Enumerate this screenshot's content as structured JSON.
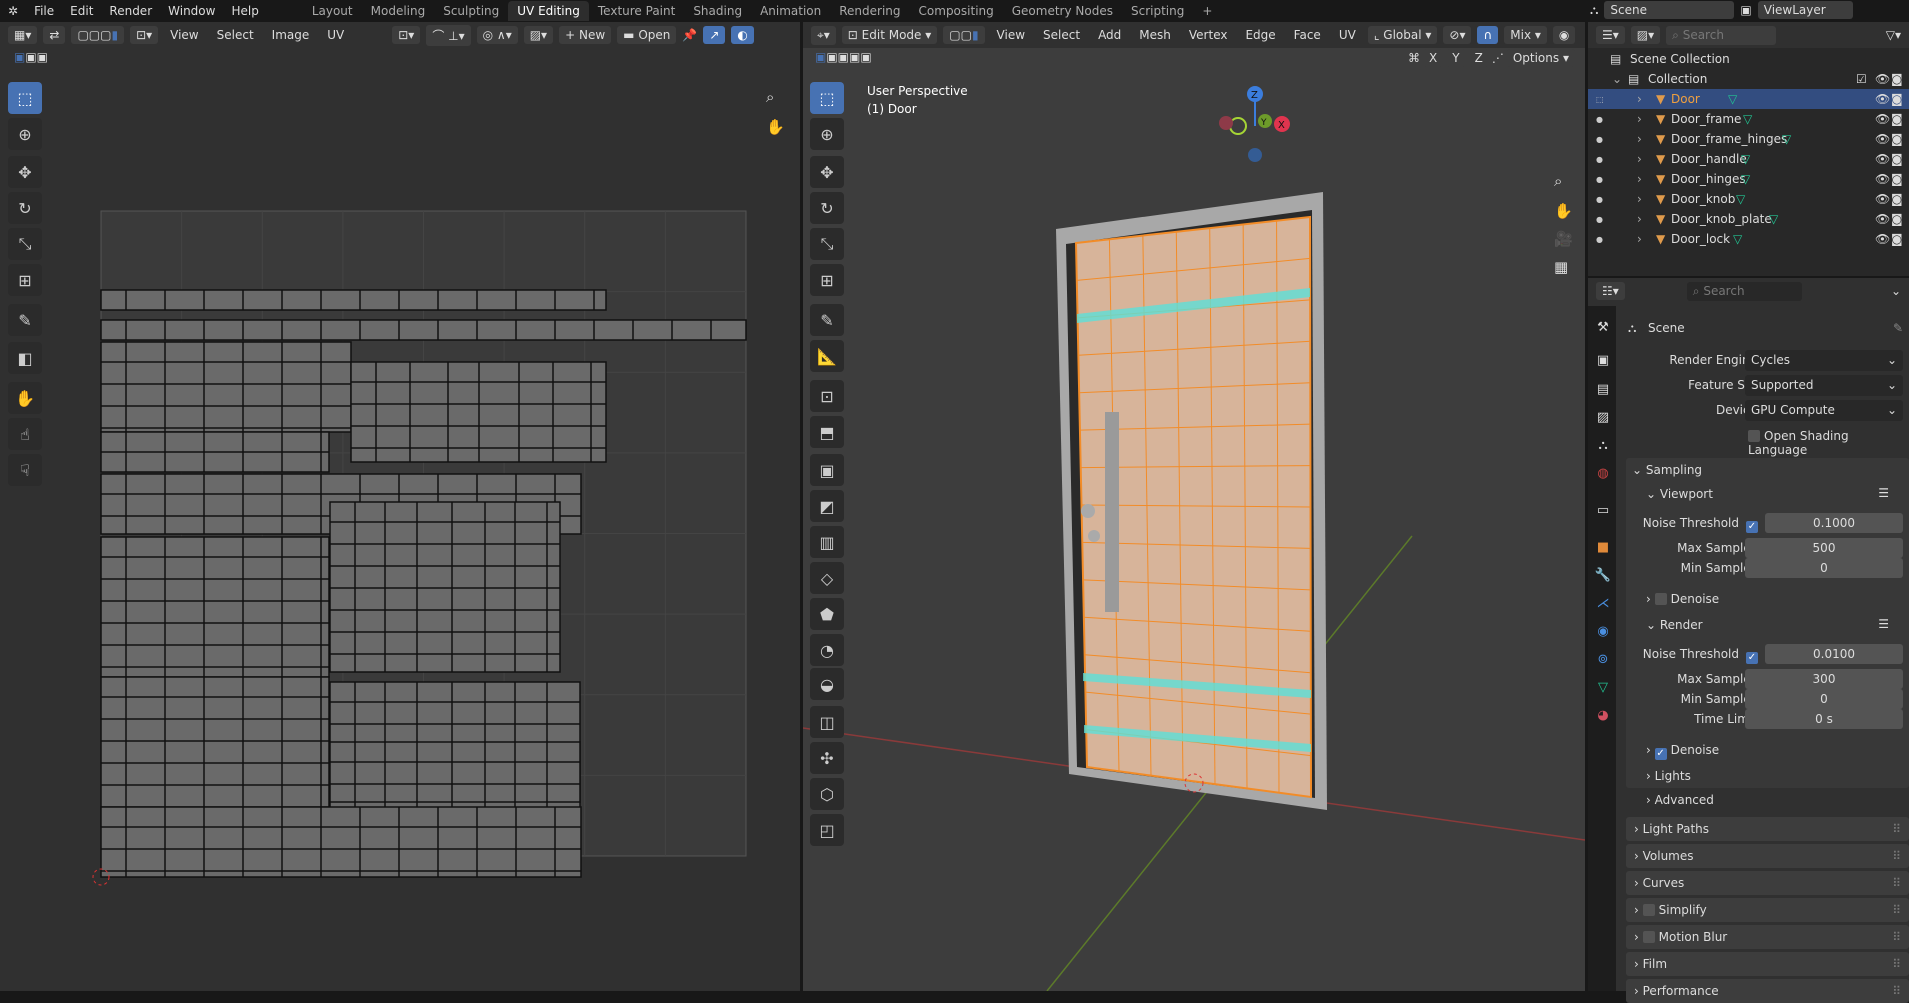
{
  "topbar": {
    "menus": [
      "File",
      "Edit",
      "Render",
      "Window",
      "Help"
    ],
    "tabs": [
      "Layout",
      "Modeling",
      "Sculpting",
      "UV Editing",
      "Texture Paint",
      "Shading",
      "Animation",
      "Rendering",
      "Compositing",
      "Geometry Nodes",
      "Scripting",
      "+"
    ],
    "active_tab": "UV Editing",
    "scene": "Scene",
    "view_layer": "ViewLayer"
  },
  "uv_editor": {
    "menus": [
      "View",
      "Select",
      "Image",
      "UV"
    ],
    "new_label": "New",
    "open_label": "Open"
  },
  "viewport": {
    "mode": "Edit Mode",
    "menus": [
      "View",
      "Select",
      "Add",
      "Mesh",
      "Vertex",
      "Edge",
      "Face",
      "UV"
    ],
    "orientation": "Global",
    "shading_mix": "Mix",
    "axes": [
      "X",
      "Y",
      "Z"
    ],
    "options_label": "Options",
    "overlay_title": "User Perspective",
    "overlay_object": "(1) Door",
    "gizmo": {
      "z": "Z",
      "y": "Y",
      "x": "X"
    }
  },
  "outliner": {
    "search_placeholder": "Search",
    "scene_collection": "Scene Collection",
    "collection": "Collection",
    "objects": [
      "Door",
      "Door_frame",
      "Door_frame_hinges",
      "Door_handle",
      "Door_hinges",
      "Door_knob",
      "Door_knob_plate",
      "Door_lock"
    ],
    "selected": "Door"
  },
  "properties": {
    "search_placeholder": "Search",
    "context": "Scene",
    "render_engine": {
      "label": "Render Engine",
      "value": "Cycles"
    },
    "feature_set": {
      "label": "Feature Set",
      "value": "Supported"
    },
    "device": {
      "label": "Device",
      "value": "GPU Compute"
    },
    "osl": {
      "label": "Open Shading Language",
      "checked": false
    },
    "sampling": {
      "label": "Sampling",
      "viewport": {
        "label": "Viewport",
        "noise_label": "Noise Threshold",
        "noise": "0.1000",
        "max_label": "Max Samples",
        "max": "500",
        "min_label": "Min Samples",
        "min": "0",
        "denoise_label": "Denoise",
        "denoise": false
      },
      "render": {
        "label": "Render",
        "noise_label": "Noise Threshold",
        "noise": "0.0100",
        "max_label": "Max Samples",
        "max": "300",
        "min_label": "Min Samples",
        "min": "0",
        "time_label": "Time Limit",
        "time": "0 s",
        "denoise_label": "Denoise",
        "denoise": true
      },
      "lights": "Lights",
      "advanced": "Advanced"
    },
    "panels": [
      "Light Paths",
      "Volumes",
      "Curves",
      "Simplify",
      "Motion Blur",
      "Film",
      "Performance"
    ]
  },
  "colors": {
    "accent": "#4772b3",
    "selection_orange": "#f28c28",
    "mesh_green": "#22c493"
  }
}
